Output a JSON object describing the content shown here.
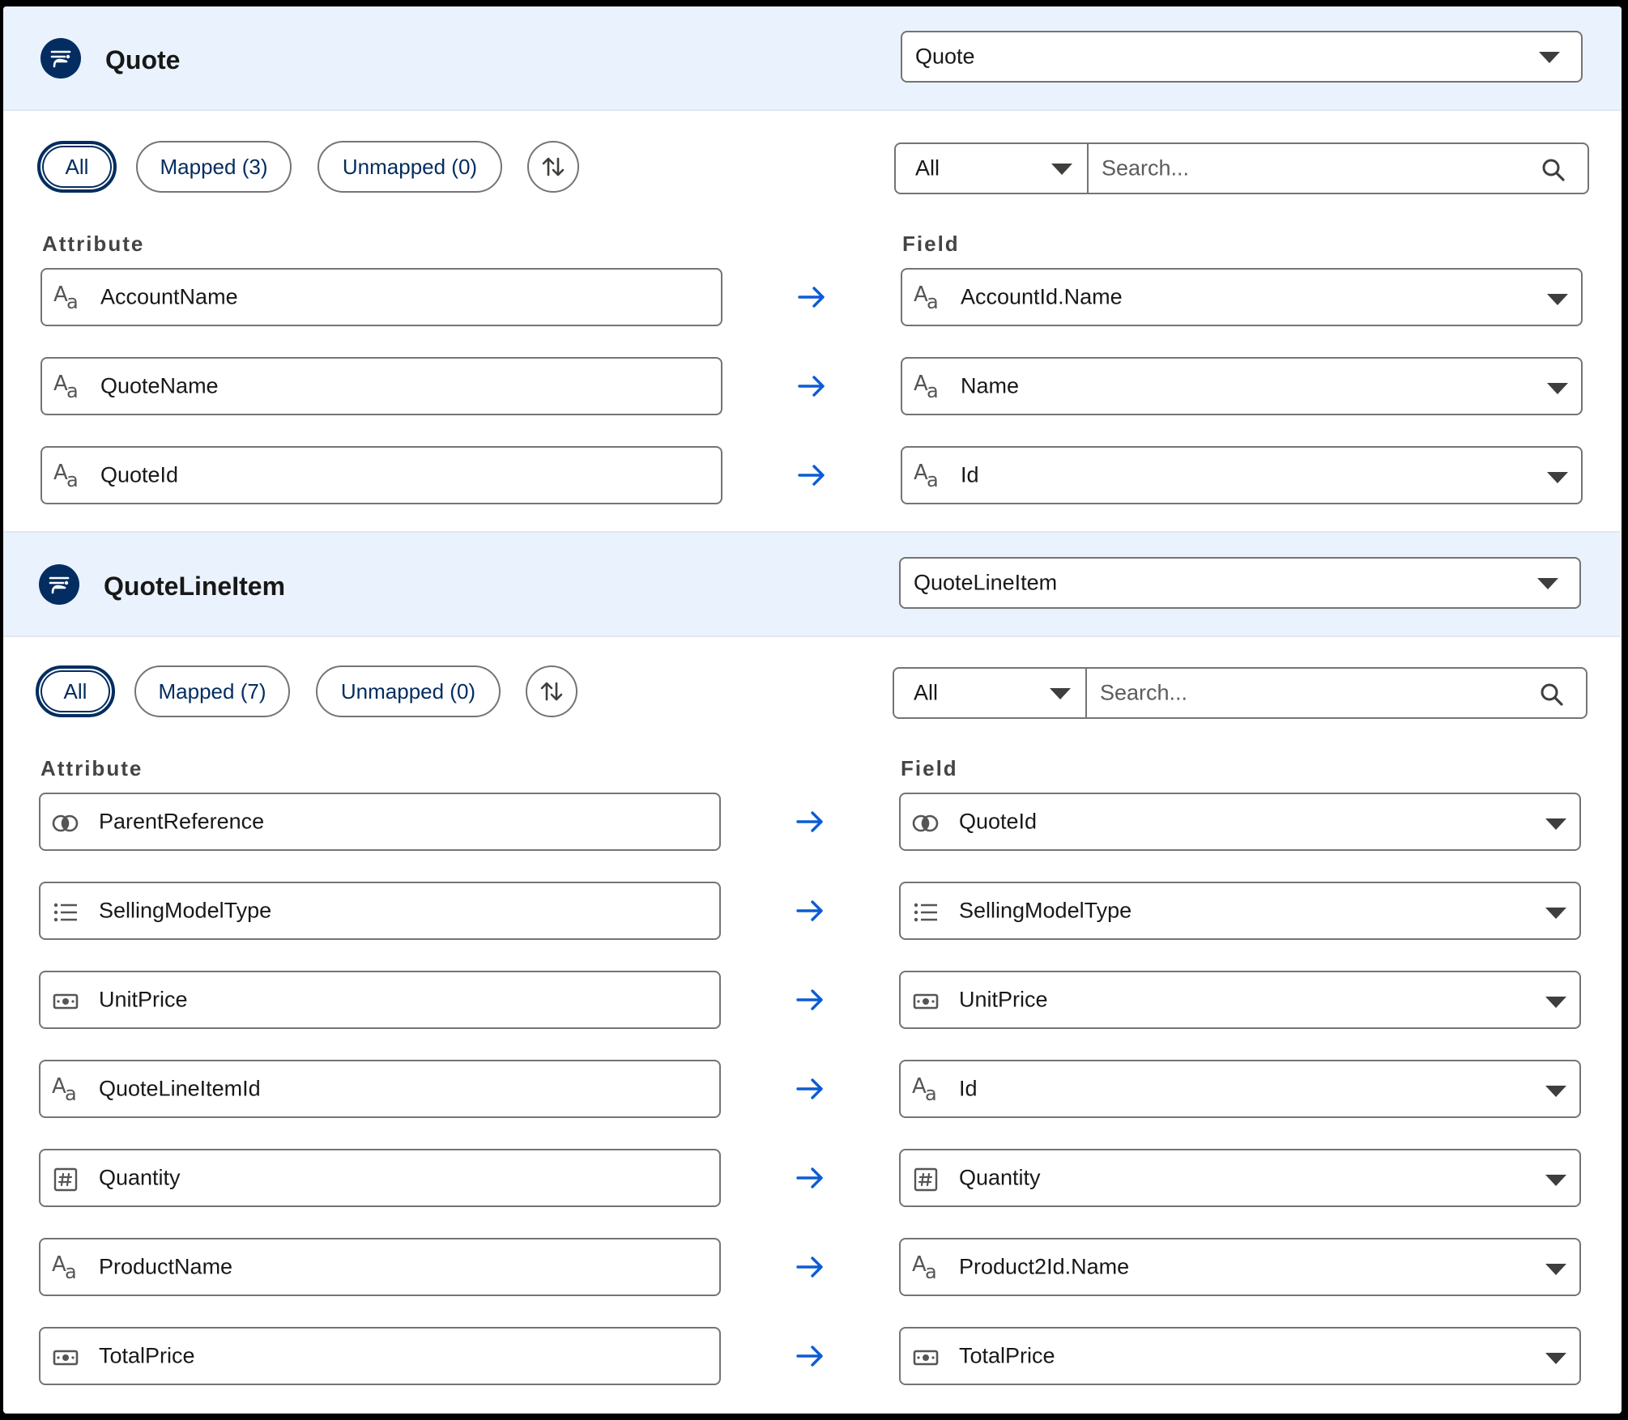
{
  "sections": [
    {
      "title": "Quote",
      "object_select": "Quote",
      "filters": {
        "all": "All",
        "mapped": "Mapped (3)",
        "unmapped": "Unmapped (0)"
      },
      "type_filter": "All",
      "search_placeholder": "Search...",
      "attribute_header": "Attribute",
      "field_header": "Field",
      "rows": [
        {
          "icon": "text-icon",
          "attribute": "AccountName",
          "field": "AccountId.Name"
        },
        {
          "icon": "text-icon",
          "attribute": "QuoteName",
          "field": "Name"
        },
        {
          "icon": "text-icon",
          "attribute": "QuoteId",
          "field": "Id"
        }
      ]
    },
    {
      "title": "QuoteLineItem",
      "object_select": "QuoteLineItem",
      "filters": {
        "all": "All",
        "mapped": "Mapped (7)",
        "unmapped": "Unmapped (0)"
      },
      "type_filter": "All",
      "search_placeholder": "Search...",
      "attribute_header": "Attribute",
      "field_header": "Field",
      "rows": [
        {
          "icon": "reference-icon",
          "attribute": "ParentReference",
          "field": "QuoteId"
        },
        {
          "icon": "picklist-icon",
          "attribute": "SellingModelType",
          "field": "SellingModelType"
        },
        {
          "icon": "currency-icon",
          "attribute": "UnitPrice",
          "field": "UnitPrice"
        },
        {
          "icon": "text-icon",
          "attribute": "QuoteLineItemId",
          "field": "Id"
        },
        {
          "icon": "number-icon",
          "attribute": "Quantity",
          "field": "Quantity"
        },
        {
          "icon": "text-icon",
          "attribute": "ProductName",
          "field": "Product2Id.Name"
        },
        {
          "icon": "currency-icon",
          "attribute": "TotalPrice",
          "field": "TotalPrice"
        }
      ]
    }
  ],
  "colors": {
    "header_bg": "#eaf2fd",
    "brand_navy": "#032d60",
    "arrow_blue": "#0b5cd5",
    "border": "#747474"
  }
}
